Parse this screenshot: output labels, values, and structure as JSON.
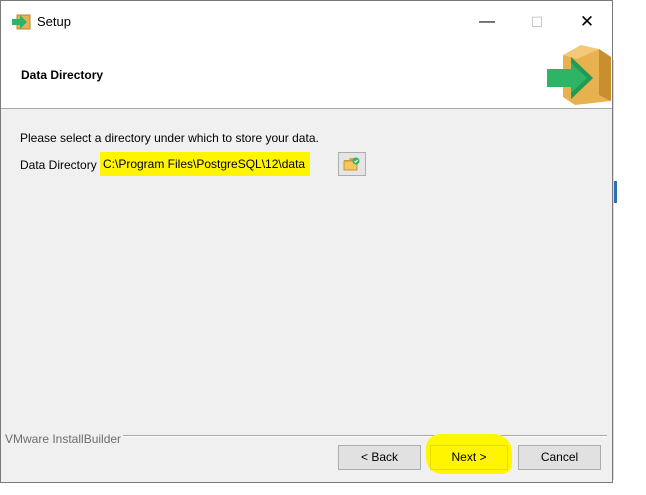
{
  "window": {
    "title": "Setup",
    "controls": {
      "minimize": "—",
      "maximize": "☐",
      "close": "✕"
    }
  },
  "header": {
    "title": "Data Directory",
    "graphic": "box-with-arrow-icon"
  },
  "main": {
    "instruction": "Please select a directory under which to store your data.",
    "field_label": "Data Directory",
    "field_value": "C:\\Program Files\\PostgreSQL\\12\\data",
    "browse_icon": "folder-browse-icon"
  },
  "footer": {
    "brand": "VMware InstallBuilder",
    "back_label": "< Back",
    "next_label": "Next >",
    "cancel_label": "Cancel"
  },
  "colors": {
    "highlight": "#fff500",
    "window_bg": "#f0f0f0",
    "header_bg": "#ffffff",
    "arrow_green": "#2db567",
    "box_tan": "#e8b14f"
  }
}
